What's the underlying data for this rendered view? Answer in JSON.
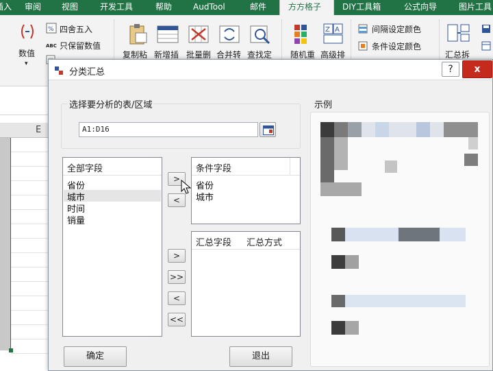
{
  "ribbon_tabs": [
    {
      "label": "插入"
    },
    {
      "label": "审阅"
    },
    {
      "label": "视图"
    },
    {
      "label": "开发工具"
    },
    {
      "label": "帮助"
    },
    {
      "label": "AudTool"
    },
    {
      "label": "邮件"
    },
    {
      "label": "方方格子"
    },
    {
      "label": "DIY工具箱"
    },
    {
      "label": "公式向导"
    },
    {
      "label": "图片工具"
    }
  ],
  "ribbon": {
    "value_label": "数值",
    "round_label": "四舍五入",
    "keep_value_label": "只保留数值",
    "copy_paste_label": "复制粘",
    "new_insert_label": "新增插",
    "batch_delete_label": "批量删",
    "merge_convert_label": "合并转",
    "find_locate_label": "查找定",
    "random_label": "随机重",
    "advanced_sort_label": "高级排",
    "interval_color_label": "间隔设定颜色",
    "condition_color_label": "条件设定颜色",
    "summary_split_label": "汇总拆",
    "abc_badge": "ABC"
  },
  "sheet": {
    "column_e": "E"
  },
  "dialog": {
    "title": "分类汇总",
    "help_label": "?",
    "close_label": "x",
    "section_label": "选择要分析的表/区域",
    "range_value": "A1:D16",
    "example_label": "示例",
    "all_fields_header": "全部字段",
    "all_fields": [
      "省份",
      "城市",
      "时间",
      "销量"
    ],
    "condition_header": "条件字段",
    "condition_fields": [
      "省份",
      "城市"
    ],
    "summary_field_header": "汇总字段",
    "summary_method_header": "汇总方式",
    "add_condition_label": ">",
    "remove_condition_label": "<",
    "add_summary_label": ">",
    "add_all_label": ">>",
    "remove_summary_label": "<",
    "remove_all_label": "<<",
    "ok_label": "确定",
    "exit_label": "退出"
  }
}
